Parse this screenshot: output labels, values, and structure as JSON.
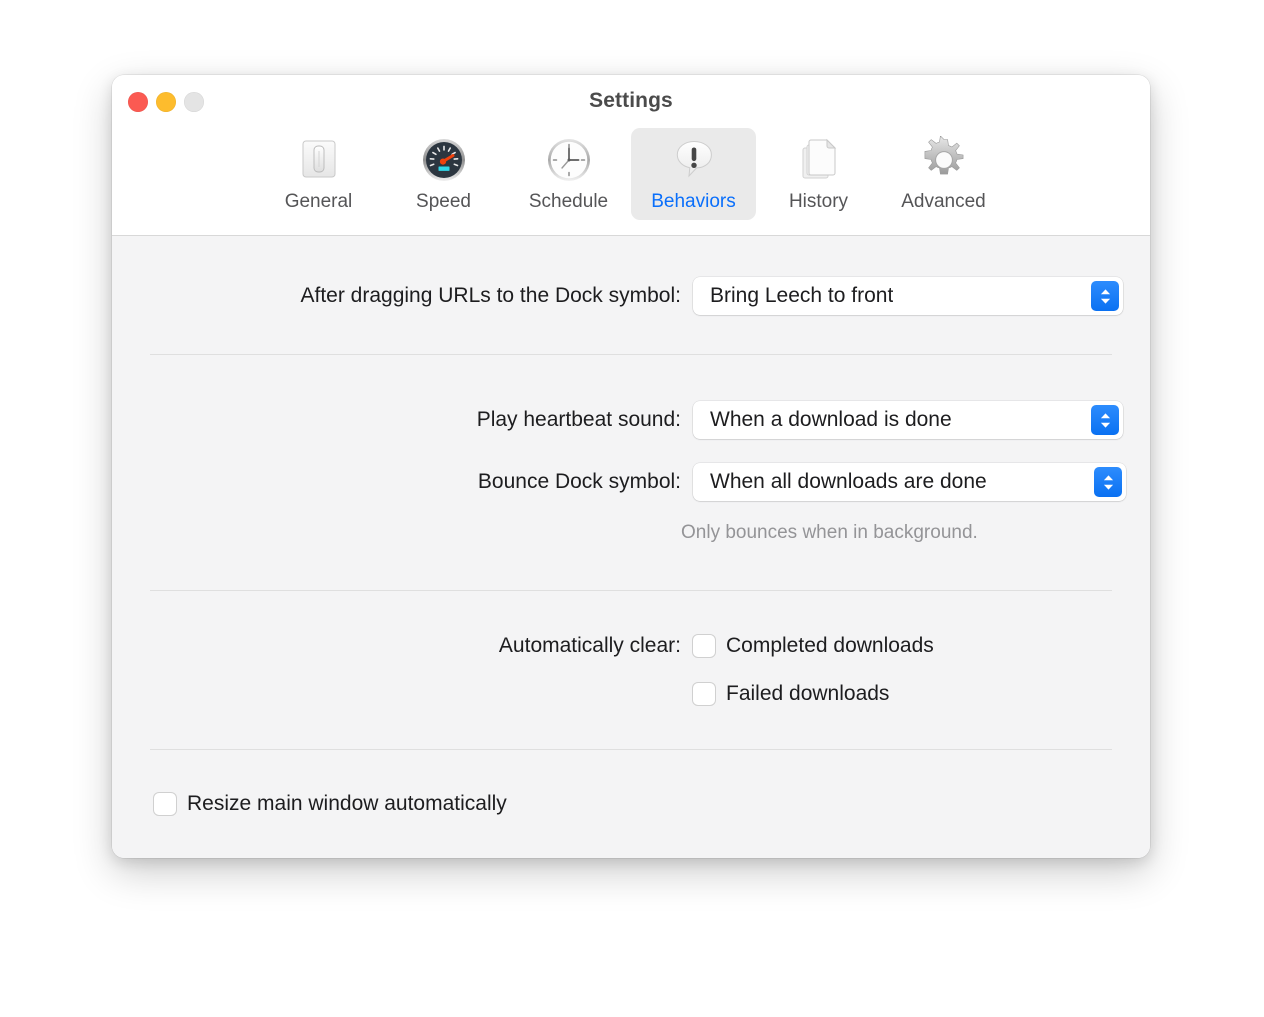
{
  "window": {
    "title": "Settings",
    "traffic_lights": [
      {
        "name": "close",
        "color": "#fb5a52"
      },
      {
        "name": "minimize",
        "color": "#fdbc2d"
      },
      {
        "name": "zoom",
        "color": "#e4e4e4"
      }
    ]
  },
  "toolbar": {
    "tabs": [
      {
        "label": "General",
        "icon": "toggle-switch-icon",
        "selected": false
      },
      {
        "label": "Speed",
        "icon": "speedometer-icon",
        "selected": false
      },
      {
        "label": "Schedule",
        "icon": "clock-icon",
        "selected": false
      },
      {
        "label": "Behaviors",
        "icon": "speech-bubble-exclamation-icon",
        "selected": true
      },
      {
        "label": "History",
        "icon": "documents-icon",
        "selected": false
      },
      {
        "label": "Advanced",
        "icon": "gear-icon",
        "selected": false
      }
    ],
    "selected_tab": "Behaviors",
    "accent_color": "#0a6ffb"
  },
  "settings": {
    "dock_drag": {
      "label": "After dragging URLs to the Dock symbol:",
      "value": "Bring Leech to front"
    },
    "heartbeat_sound": {
      "label": "Play heartbeat sound:",
      "value": "When a download is done"
    },
    "bounce_dock": {
      "label": "Bounce Dock symbol:",
      "value": "When all downloads are done",
      "hint": "Only bounces when in background."
    },
    "auto_clear": {
      "label": "Automatically clear:",
      "options": [
        {
          "label": "Completed downloads",
          "checked": false
        },
        {
          "label": "Failed downloads",
          "checked": false
        }
      ]
    },
    "resize_window": {
      "label": "Resize main window automatically",
      "checked": false
    }
  }
}
